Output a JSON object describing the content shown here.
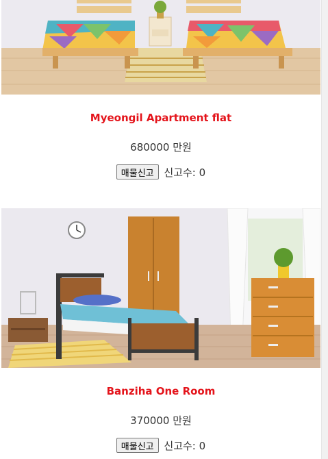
{
  "listings": [
    {
      "title": "Myeongil Apartment flat",
      "price": "680000 만원",
      "report_button": "매물신고",
      "report_label": "신고수:",
      "report_count": "0"
    },
    {
      "title": "Banziha One Room",
      "price": "370000 만원",
      "report_button": "매물신고",
      "report_label": "신고수:",
      "report_count": "0"
    }
  ],
  "colors": {
    "title": "#e4141b",
    "text": "#333333"
  }
}
